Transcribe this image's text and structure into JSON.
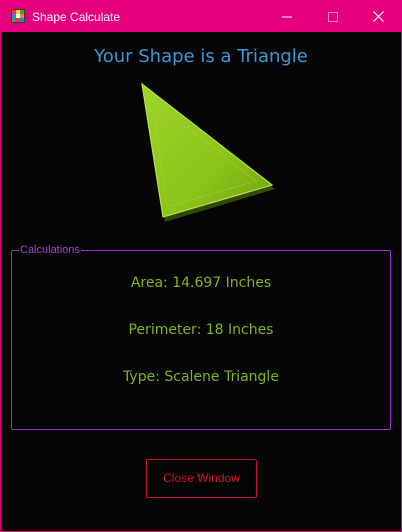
{
  "window": {
    "title": "Shape Calculate",
    "border_color": "#e6007e",
    "titlebar_color": "#e4007c",
    "controls": {
      "minimize_icon": "minimize-icon",
      "maximize_icon": "maximize-icon",
      "close_icon": "close-icon"
    }
  },
  "main": {
    "heading": "Your Shape is a Triangle",
    "shape_icon": "triangle-icon",
    "shape_color": "#8cc41a"
  },
  "calculations": {
    "legend": "Calculations",
    "area": "Area: 14.697 Inches",
    "perimeter": "Perimeter: 18 Inches",
    "type": "Type: Scalene Triangle"
  },
  "actions": {
    "close_label": "Close Window"
  }
}
